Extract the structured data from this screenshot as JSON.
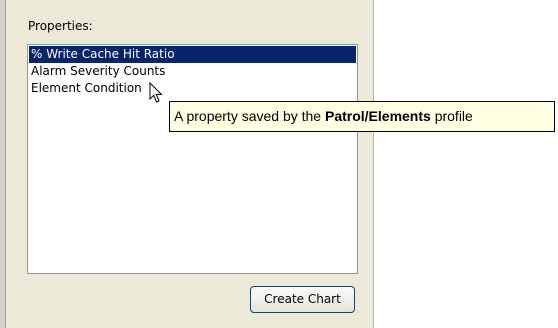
{
  "properties_panel": {
    "label": "Properties:",
    "list_items": [
      {
        "label": "% Write Cache Hit Ratio",
        "selected": true
      },
      {
        "label": "Alarm Severity Counts",
        "selected": false
      },
      {
        "label": "Element Condition",
        "selected": false
      }
    ],
    "create_chart_label": "Create Chart"
  },
  "tooltip": {
    "prefix": "A property saved by the ",
    "profile_name": "Patrol/Elements",
    "suffix": " profile"
  },
  "colors": {
    "panel_background": "#ece9d8",
    "selection_background": "#0a246a",
    "tooltip_background": "#ffffe1",
    "listbox_border": "#7f9db9"
  },
  "icons": {
    "cursor": "arrow-pointer-icon"
  }
}
